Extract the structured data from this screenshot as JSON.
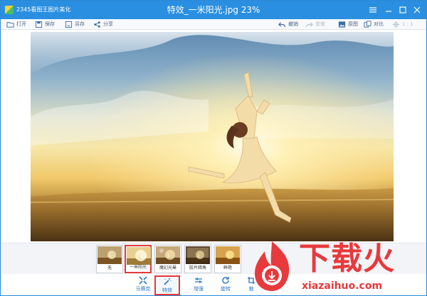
{
  "app": {
    "name": "2345看图王图片美化",
    "title": "特效_一米阳光.jpg 23%"
  },
  "toolbar": {
    "open": "打开",
    "save": "保存",
    "save_as": "另存",
    "share": "分享",
    "undo": "撤销",
    "redo": "重做",
    "original": "原图",
    "compare": "对比",
    "ratio": "1 : 1"
  },
  "filters": [
    {
      "label": "无",
      "selected": false
    },
    {
      "label": "一米阳光",
      "selected": true
    },
    {
      "label": "魔幻光晕",
      "selected": false
    },
    {
      "label": "胶片暗角",
      "selected": false
    },
    {
      "label": "鲜艳",
      "selected": false
    }
  ],
  "bottom": {
    "mosaic": "马赛克",
    "effects": "特效",
    "enhance": "增强",
    "rotate": "旋转",
    "crop": "裁"
  },
  "watermark": {
    "cn": "下载火",
    "en": "xiazaihuo.com"
  },
  "colors": {
    "titlebar": "#2a8fe0",
    "accent": "#2a77c4",
    "highlight": "#e23a3a",
    "watermark": "#e8393c"
  }
}
